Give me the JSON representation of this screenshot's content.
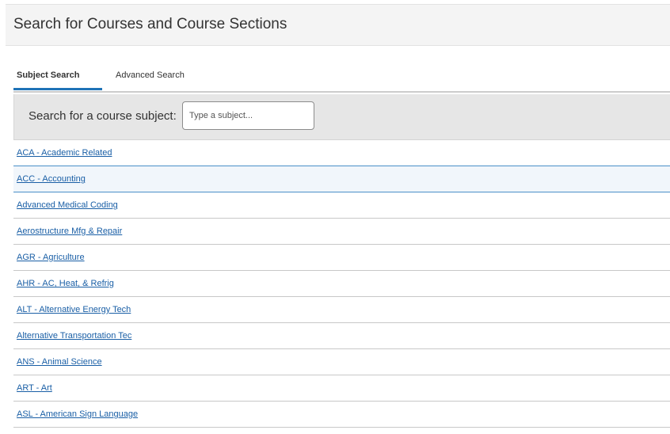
{
  "header": {
    "title": "Search for Courses and Course Sections"
  },
  "tabs": [
    {
      "label": "Subject Search",
      "active": true
    },
    {
      "label": "Advanced Search",
      "active": false
    }
  ],
  "search": {
    "label": "Search for a course subject:",
    "placeholder": "Type a subject...",
    "value": ""
  },
  "subjects": [
    {
      "label": "ACA - Academic Related",
      "highlighted": false
    },
    {
      "label": "ACC - Accounting",
      "highlighted": true
    },
    {
      "label": "Advanced Medical Coding",
      "highlighted": false
    },
    {
      "label": "Aerostructure Mfg & Repair",
      "highlighted": false
    },
    {
      "label": "AGR - Agriculture",
      "highlighted": false
    },
    {
      "label": "AHR - AC, Heat, & Refrig",
      "highlighted": false
    },
    {
      "label": "ALT - Alternative Energy Tech",
      "highlighted": false
    },
    {
      "label": "Alternative Transportation Tec",
      "highlighted": false
    },
    {
      "label": "ANS - Animal Science",
      "highlighted": false
    },
    {
      "label": "ART - Art",
      "highlighted": false
    },
    {
      "label": "ASL - American Sign Language",
      "highlighted": false
    }
  ],
  "colors": {
    "accent": "#1f73b7",
    "link": "#1a5fa6",
    "highlight_row": "#f1f6fb"
  }
}
